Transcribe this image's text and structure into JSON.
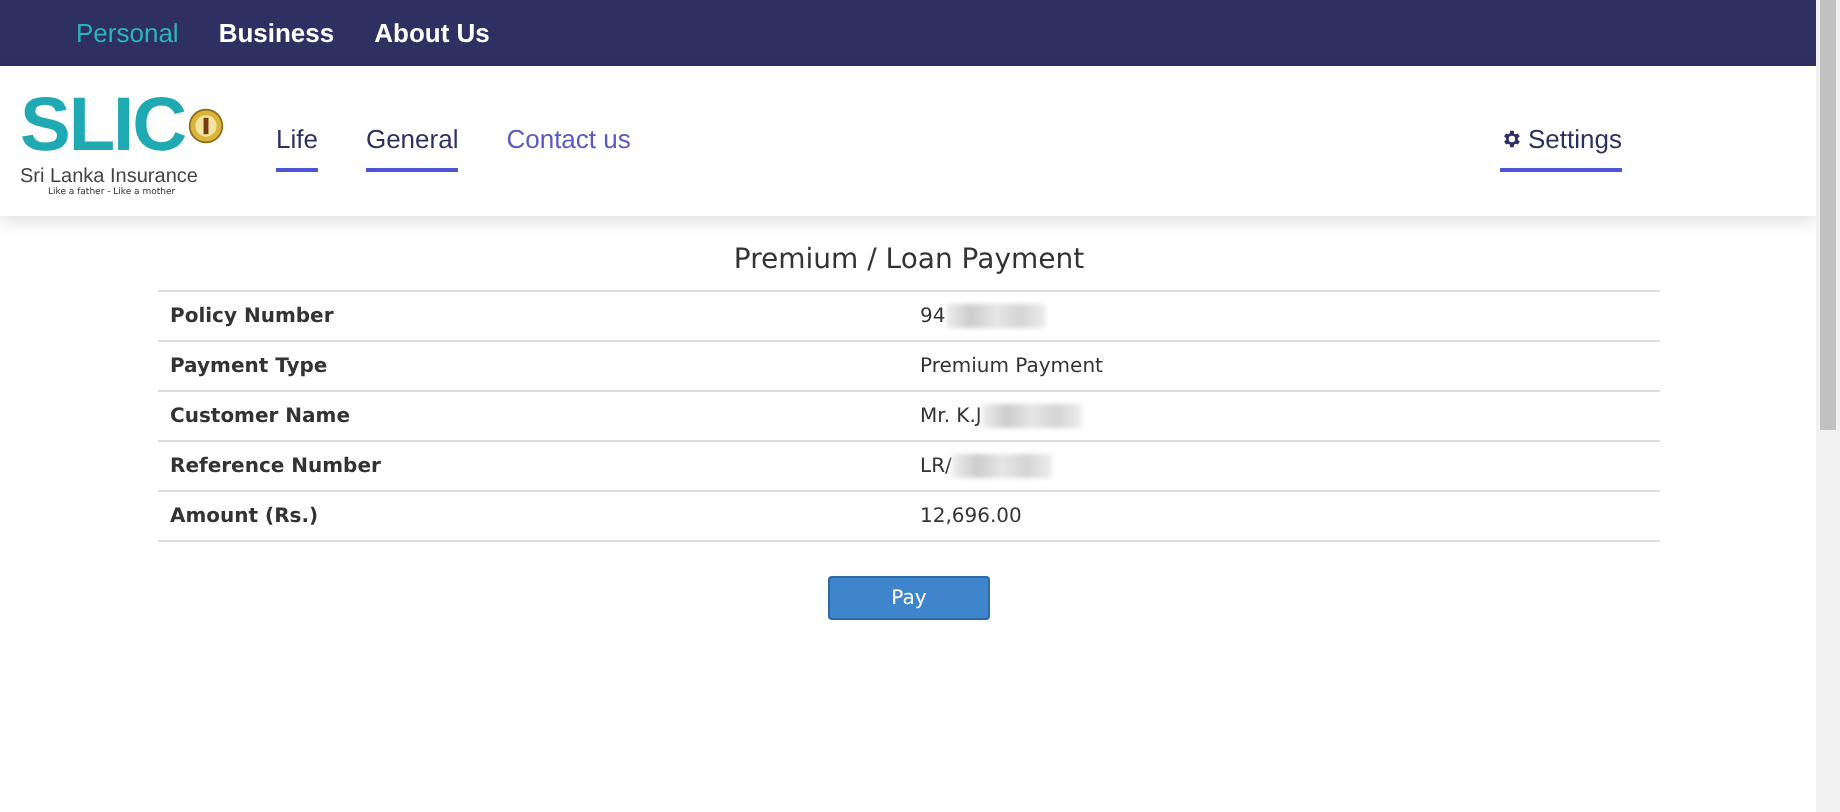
{
  "top_nav": [
    {
      "label": "Personal",
      "selected": true
    },
    {
      "label": "Business",
      "selected": false
    },
    {
      "label": "About Us",
      "selected": false
    }
  ],
  "logo": {
    "mark": "SLIC",
    "name": "Sri Lanka Insurance",
    "tagline": "Like a father - Like a mother"
  },
  "main_nav": [
    {
      "label": "Life",
      "underlined": true,
      "highlighted": false
    },
    {
      "label": "General",
      "underlined": true,
      "highlighted": false
    },
    {
      "label": "Contact us",
      "underlined": false,
      "highlighted": true
    }
  ],
  "settings": {
    "label": "Settings",
    "underlined": true
  },
  "title": "Premium / Loan Payment",
  "rows": [
    {
      "label": "Policy Number",
      "value": "94",
      "redacted": true
    },
    {
      "label": "Payment Type",
      "value": "Premium Payment",
      "redacted": false
    },
    {
      "label": "Customer Name",
      "value": "Mr. K.J",
      "redacted": true
    },
    {
      "label": "Reference Number",
      "value": "LR/",
      "redacted": true
    },
    {
      "label": "Amount (Rs.)",
      "value": "12,696.00",
      "redacted": false
    }
  ],
  "button": "Pay"
}
